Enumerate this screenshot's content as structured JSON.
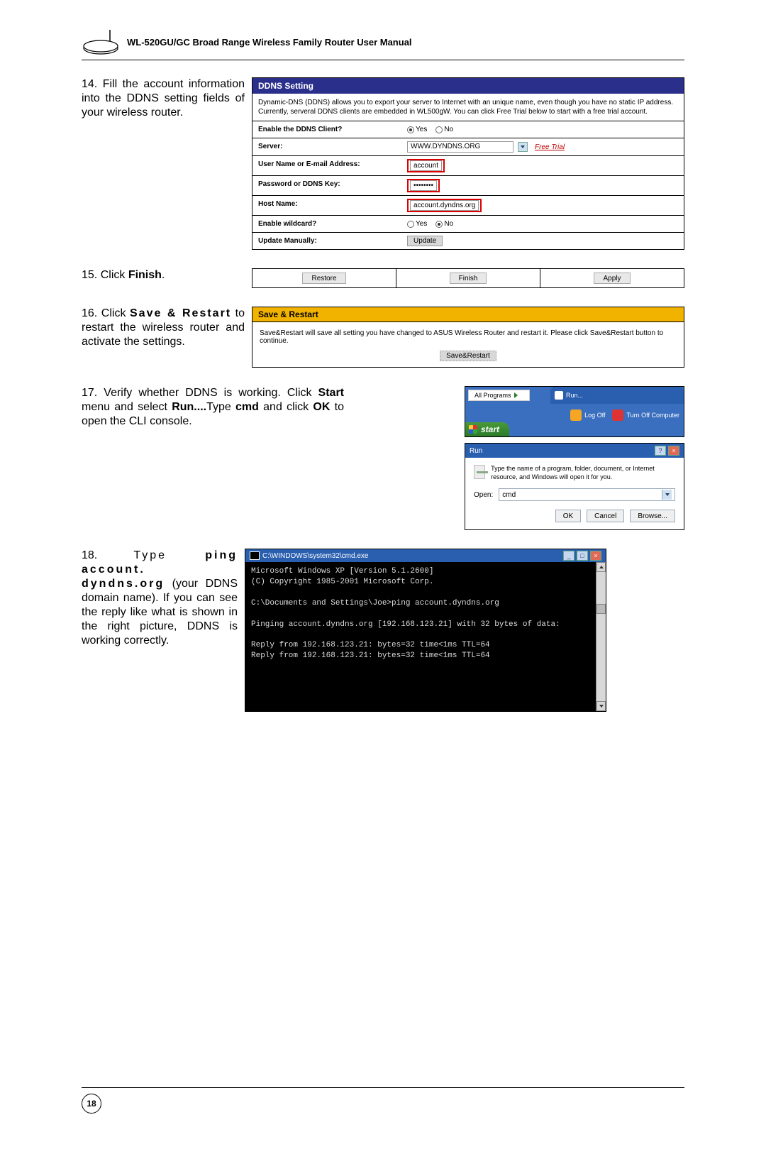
{
  "header": {
    "title": "WL-520GU/GC Broad Range Wireless Family Router User Manual"
  },
  "steps": {
    "s14": {
      "num": "14.",
      "text": "Fill the account information into the DDNS setting fields of your wireless router."
    },
    "s15": {
      "num": "15.",
      "text_a": "Click ",
      "bold": "Finish",
      "text_b": "."
    },
    "s16": {
      "num": "16.",
      "text_a": "Click ",
      "bold": "Save & Restart",
      "text_b": " to restart the wireless router and activate the settings."
    },
    "s17": {
      "num": "17.",
      "text_a": "Verify whether DDNS is working. Click ",
      "b1": "Start",
      "t2": " menu and select ",
      "b2": "Run....",
      "t3": "Type ",
      "b3": "cmd",
      "t4": " and click ",
      "b4": "OK",
      "t5": " to open the CLI console."
    },
    "s18": {
      "num": "18.",
      "t1": "Type ",
      "b1": "ping account.\ndyndns.org",
      "t2": " (your DDNS domain name). If you can see the reply like what is shown in the right picture, DDNS is working correctly."
    }
  },
  "ddns": {
    "title": "DDNS Setting",
    "desc": "Dynamic-DNS (DDNS) allows you to export your server to Internet with an unique name, even though you have no static IP address. Currently, serveral DDNS clients are embedded in WL500gW. You can click Free Trial below to start with a free trial account.",
    "rows": {
      "enable": {
        "label": "Enable the DDNS Client?",
        "yes": "Yes",
        "no": "No"
      },
      "server": {
        "label": "Server:",
        "value": "WWW.DYNDNS.ORG",
        "trial": "Free Trial"
      },
      "user": {
        "label": "User Name or E-mail Address:",
        "value": "account"
      },
      "pass": {
        "label": "Password or DDNS Key:",
        "value": "••••••••"
      },
      "host": {
        "label": "Host Name:",
        "value": "account.dyndns.org"
      },
      "wild": {
        "label": "Enable wildcard?",
        "yes": "Yes",
        "no": "No"
      },
      "upd": {
        "label": "Update Manually:",
        "btn": "Update"
      }
    }
  },
  "btnbar": {
    "restore": "Restore",
    "finish": "Finish",
    "apply": "Apply"
  },
  "save": {
    "title": "Save & Restart",
    "desc": "Save&Restart will save all setting you have changed to ASUS Wireless Router and restart it. Please click Save&Restart button to continue.",
    "btn": "Save&Restart"
  },
  "startmenu": {
    "allprograms": "All Programs",
    "run": "Run...",
    "logoff": "Log Off",
    "turnoff": "Turn Off Computer",
    "start": "start"
  },
  "rundlg": {
    "title": "Run",
    "desc": "Type the name of a program, folder, document, or Internet resource, and Windows will open it for you.",
    "openlabel": "Open:",
    "value": "cmd",
    "ok": "OK",
    "cancel": "Cancel",
    "browse": "Browse..."
  },
  "cmd": {
    "title": "C:\\WINDOWS\\system32\\cmd.exe",
    "line1": "Microsoft Windows XP [Version 5.1.2600]",
    "line2": "(C) Copyright 1985-2001 Microsoft Corp.",
    "line3": "C:\\Documents and Settings\\Joe>ping account.dyndns.org",
    "line4": "Pinging account.dyndns.org [192.168.123.21] with 32 bytes of data:",
    "line5": "Reply from 192.168.123.21: bytes=32 time<1ms TTL=64",
    "line6": "Reply from 192.168.123.21: bytes=32 time<1ms TTL=64"
  },
  "footer": {
    "page": "18"
  }
}
